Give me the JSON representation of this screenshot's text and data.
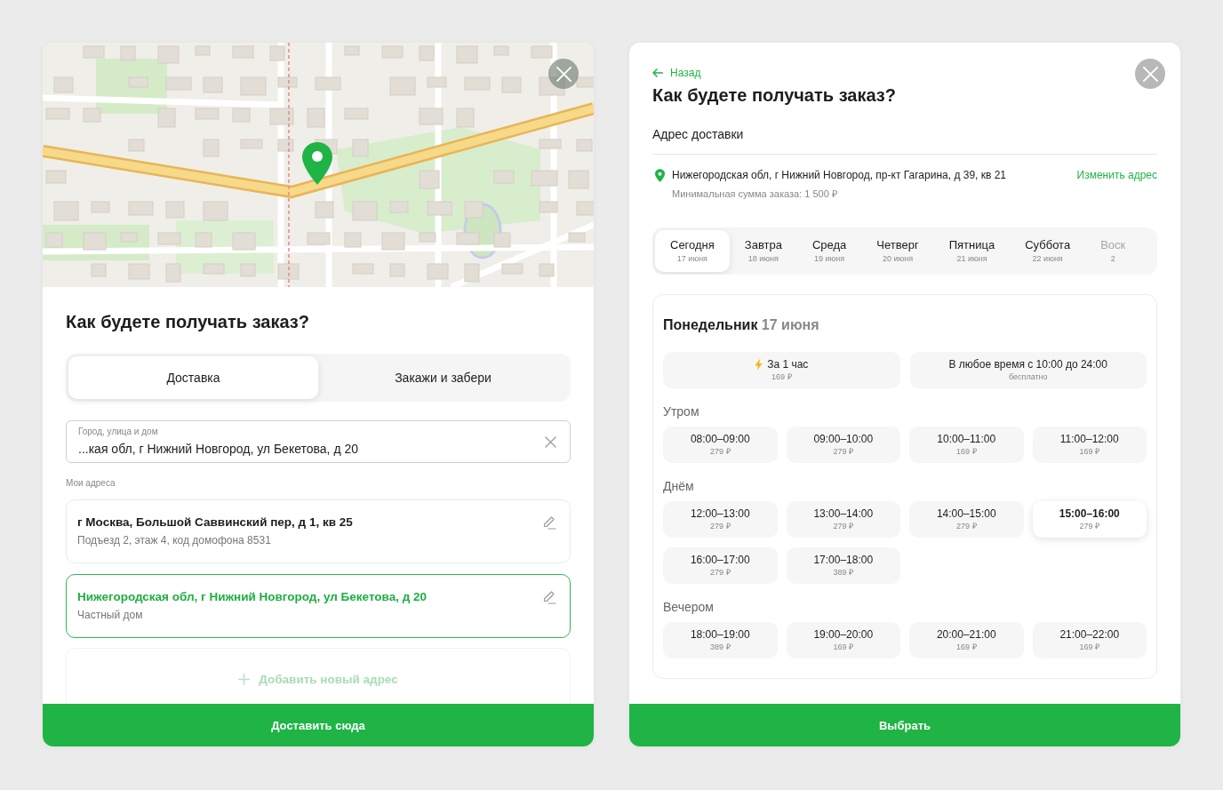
{
  "delivery_dialog": {
    "title": "Как будете получать заказ?",
    "modes": [
      {
        "label": "Доставка",
        "selected": true
      },
      {
        "label": "Закажи и забери",
        "selected": false
      }
    ],
    "address_field": {
      "label": "Город, улица и дом",
      "value": "...кая обл, г Нижний Новгород, ул Бекетова, д 20"
    },
    "saved_heading": "Мои адреса",
    "saved_addresses": [
      {
        "title": "г Москва, Большой Саввинский пер, д 1, кв 25",
        "note": "Подъезд 2, этаж 4, код домофона 8531",
        "selected": false
      },
      {
        "title": "Нижегородская обл, г Нижний Новгород, ул Бекетова, д 20",
        "note": "Частный дом",
        "selected": true
      }
    ],
    "add_address": "Добавить новый адрес",
    "submit": "Доставить сюда"
  },
  "time_dialog": {
    "back": "Назад",
    "title": "Как будете получать заказ?",
    "address_heading": "Адрес доставки",
    "address": "Нижегородская обл, г Нижний Новгород, пр-кт Гагарина, д 39, кв 21",
    "change_address": "Изменить адрес",
    "min_order": "Минимальная сумма заказа: 1 500 ₽",
    "days": [
      {
        "name": "Сегодня",
        "date": "17 июня",
        "selected": true
      },
      {
        "name": "Завтра",
        "date": "18 июня",
        "selected": false
      },
      {
        "name": "Среда",
        "date": "19 июня",
        "selected": false
      },
      {
        "name": "Четверг",
        "date": "20 июня",
        "selected": false
      },
      {
        "name": "Пятница",
        "date": "21 июня",
        "selected": false
      },
      {
        "name": "Суббота",
        "date": "22 июня",
        "selected": false
      },
      {
        "name": "Воск",
        "date": "2",
        "selected": false
      }
    ],
    "schedule": {
      "day": "Понедельник",
      "date": "17 июня",
      "options": [
        {
          "kind": "express",
          "label": "За 1 час",
          "price": "169 ₽",
          "selected": false
        },
        {
          "kind": "anytime",
          "label": "В любое время с 10:00 до 24:00",
          "price": "бесплатно",
          "selected": false
        }
      ],
      "periods": [
        {
          "name": "Утром",
          "slots": [
            {
              "time": "08:00–09:00",
              "price": "279 ₽",
              "selected": false
            },
            {
              "time": "09:00–10:00",
              "price": "279 ₽",
              "selected": false
            },
            {
              "time": "10:00–11:00",
              "price": "169 ₽",
              "selected": false
            },
            {
              "time": "11:00–12:00",
              "price": "169 ₽",
              "selected": false
            }
          ]
        },
        {
          "name": "Днём",
          "slots": [
            {
              "time": "12:00–13:00",
              "price": "279 ₽",
              "selected": false
            },
            {
              "time": "13:00–14:00",
              "price": "279 ₽",
              "selected": false
            },
            {
              "time": "14:00–15:00",
              "price": "279 ₽",
              "selected": false
            },
            {
              "time": "15:00–16:00",
              "price": "279 ₽",
              "selected": true
            },
            {
              "time": "16:00–17:00",
              "price": "279 ₽",
              "selected": false
            },
            {
              "time": "17:00–18:00",
              "price": "389 ₽",
              "selected": false
            }
          ]
        },
        {
          "name": "Вечером",
          "slots": [
            {
              "time": "18:00–19:00",
              "price": "389 ₽",
              "selected": false
            },
            {
              "time": "19:00–20:00",
              "price": "169 ₽",
              "selected": false
            },
            {
              "time": "20:00–21:00",
              "price": "169 ₽",
              "selected": false
            },
            {
              "time": "21:00–22:00",
              "price": "169 ₽",
              "selected": false
            }
          ]
        }
      ]
    },
    "submit": "Выбрать"
  }
}
